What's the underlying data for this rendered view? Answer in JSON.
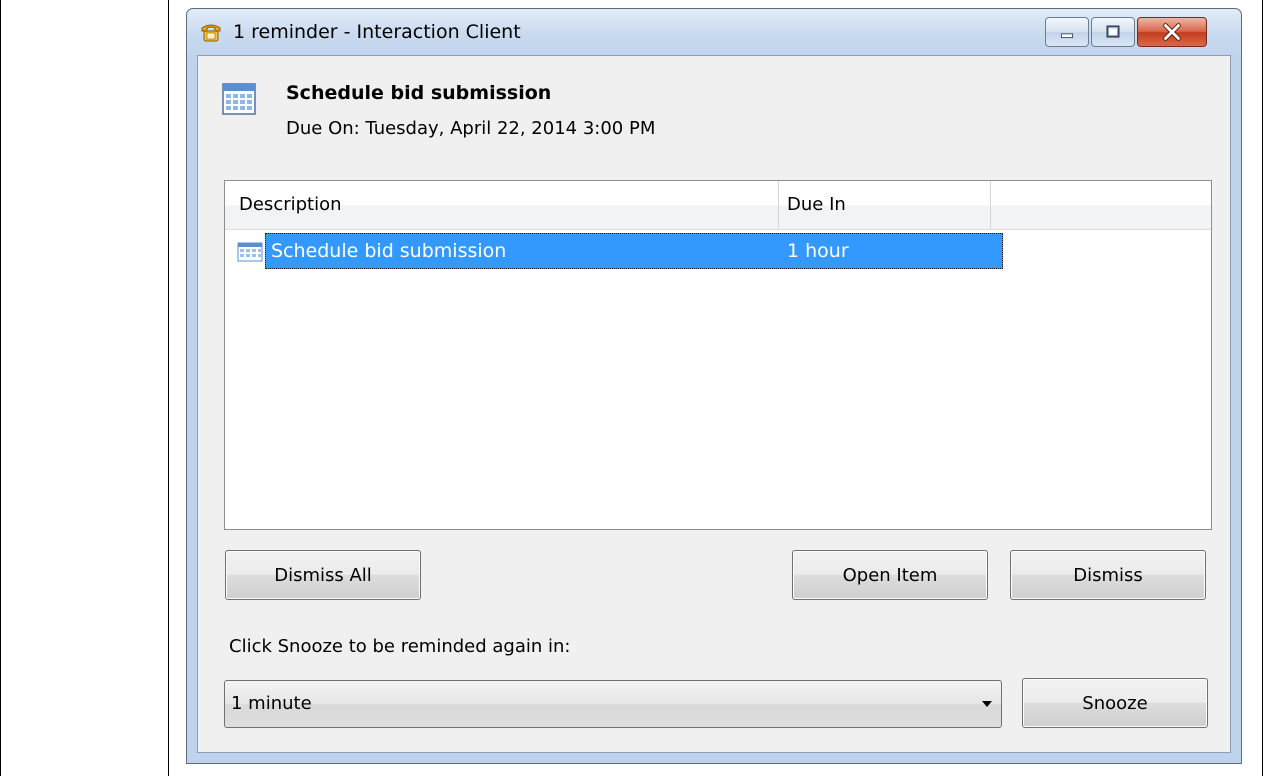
{
  "window": {
    "title": "1 reminder - Interaction Client"
  },
  "reminder": {
    "subject": "Schedule bid submission",
    "due_on": "Due On: Tuesday, April 22, 2014 3:00 PM"
  },
  "list": {
    "columns": [
      "Description",
      "Due In",
      ""
    ],
    "rows": [
      {
        "description": "Schedule bid submission",
        "due_in": "1 hour",
        "selected": true
      }
    ]
  },
  "buttons": {
    "dismiss_all": "Dismiss All",
    "open_item": "Open Item",
    "dismiss": "Dismiss",
    "snooze": "Snooze"
  },
  "snooze": {
    "label": "Click Snooze to be reminded again in:",
    "selected": "1 minute"
  },
  "icons": {
    "app": "phone-icon",
    "reminder": "calendar-icon",
    "row": "calendar-icon"
  },
  "colors": {
    "selection": "#3399ff",
    "close_button": "#c9462b"
  }
}
